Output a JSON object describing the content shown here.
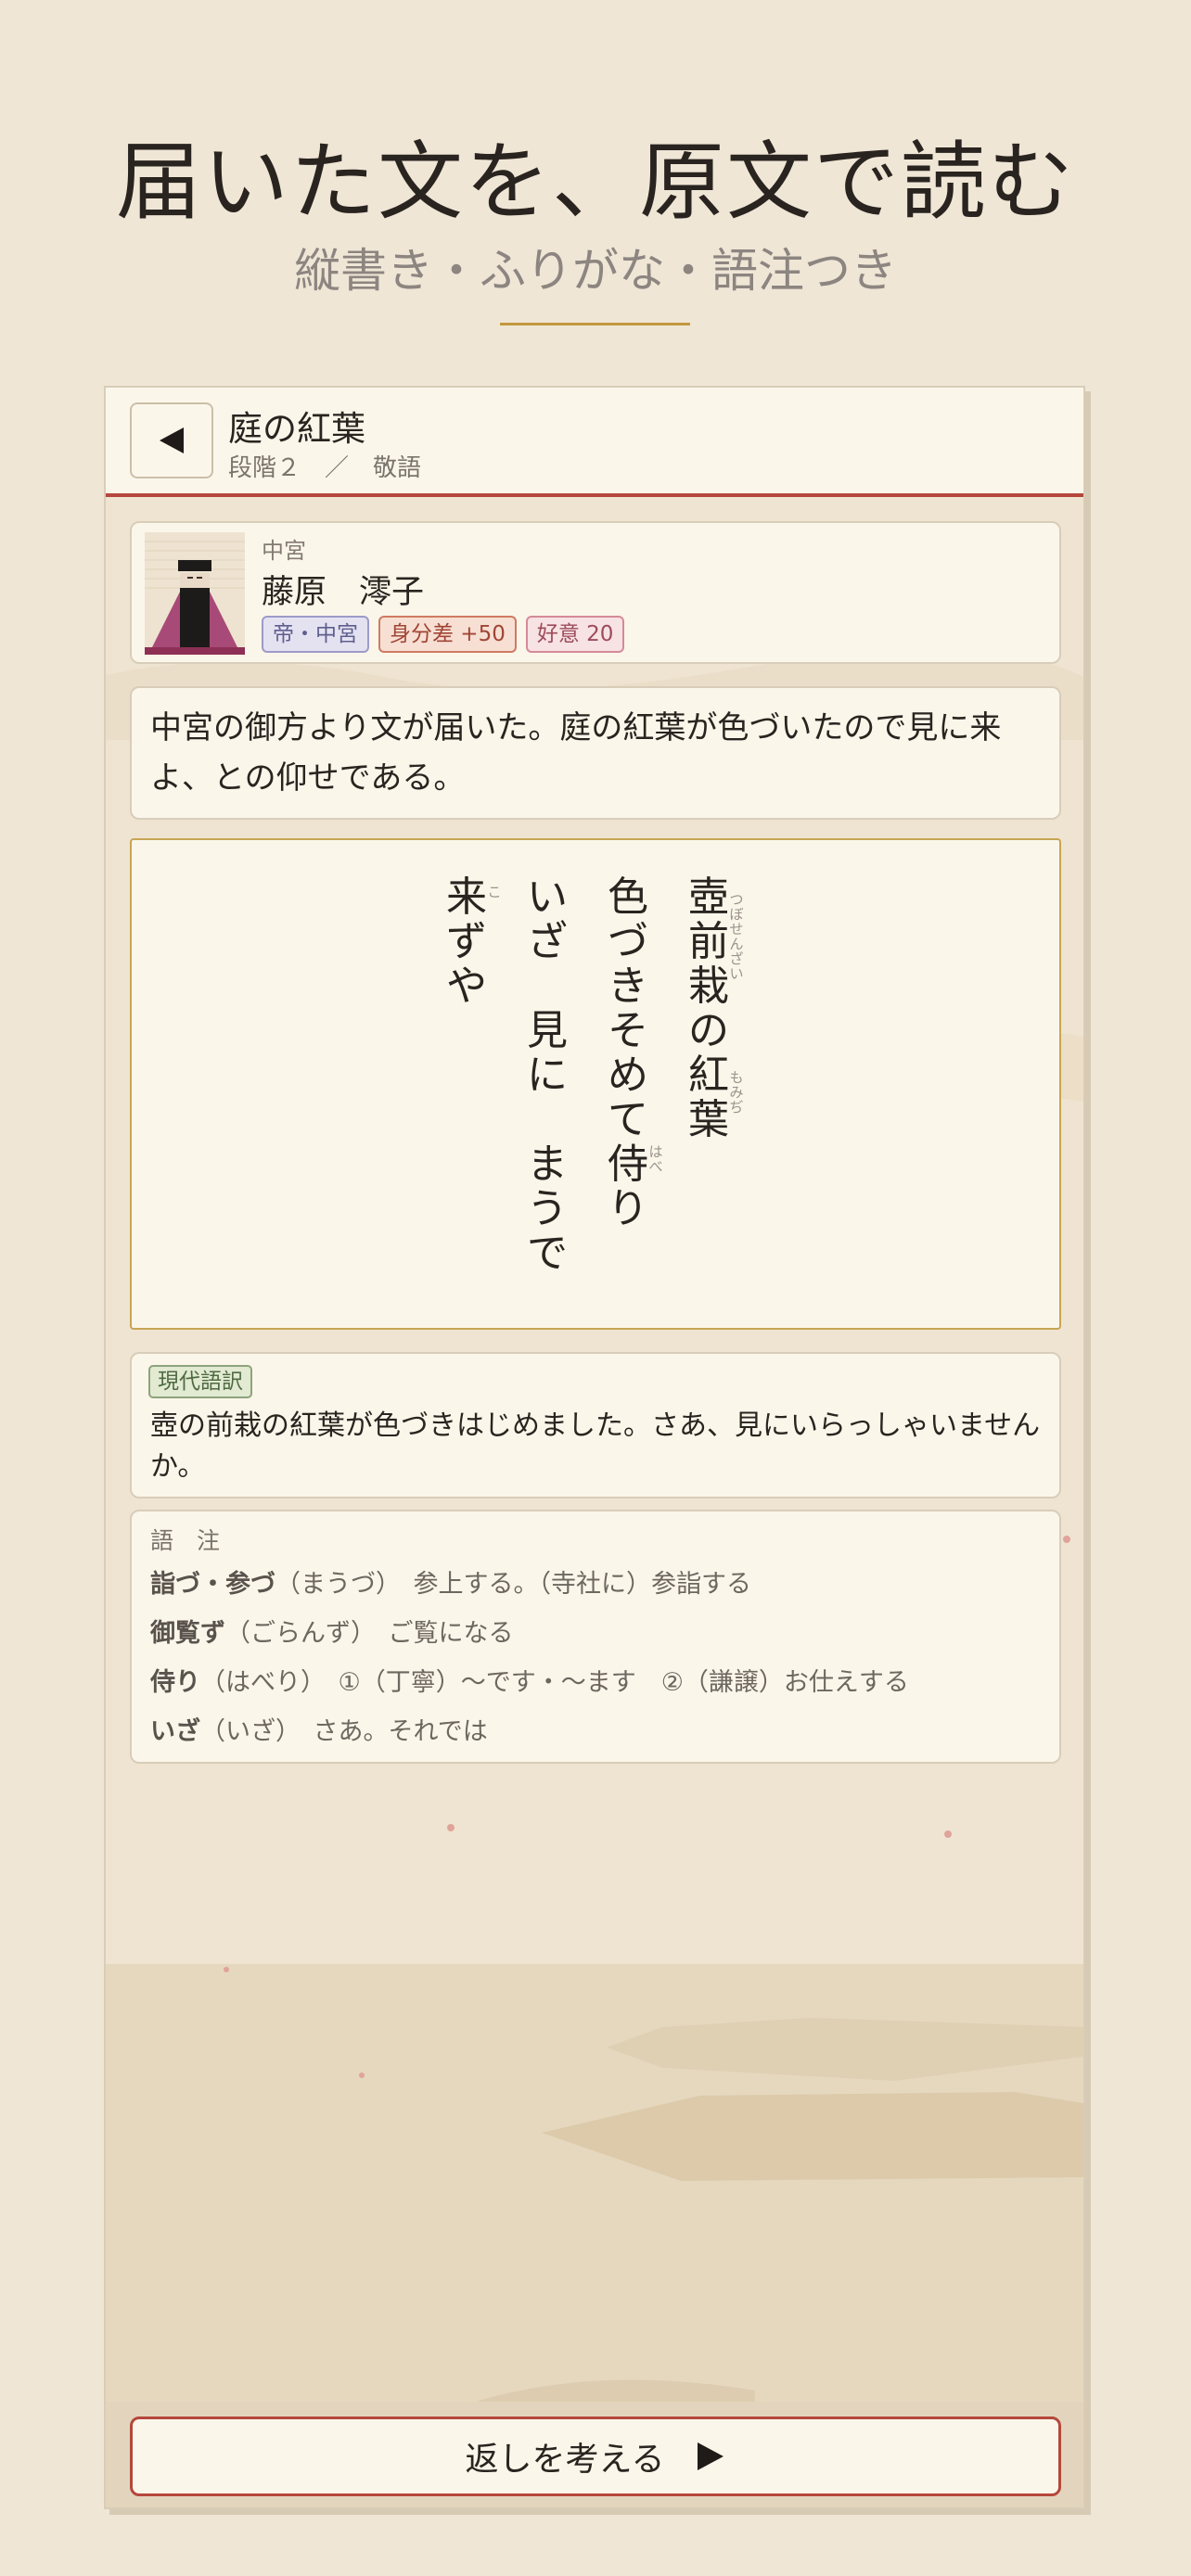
{
  "hero": {
    "title": "届いた文を、原文で読む",
    "subtitle": "縦書き・ふりがな・語注つき"
  },
  "header": {
    "back_icon": "triangle-left-icon",
    "title": "庭の紅葉",
    "meta": "段階２　／　敬語"
  },
  "sender": {
    "rank": "中宮",
    "name": "藤原　澪子",
    "badges": [
      "帝・中宮",
      "身分差 +50",
      "好意 20"
    ]
  },
  "narration": "中宮の御方より文が届いた。庭の紅葉が色づいたので見に来よ、との仰せである。",
  "poem": {
    "lines": [
      {
        "text": "壺前栽の紅葉",
        "ruby": [
          {
            "at": 0,
            "span": 3,
            "text": "つぼせんざい"
          },
          {
            "at": 4,
            "span": 2,
            "text": "もみぢ"
          }
        ]
      },
      {
        "text": "色づきそめて侍り",
        "ruby": [
          {
            "at": 6,
            "span": 1,
            "text": "はべ"
          }
        ]
      },
      {
        "text": "いざ　見に　まうで",
        "ruby": []
      },
      {
        "text": "来ずや",
        "ruby": [
          {
            "at": 0,
            "span": 1,
            "text": "こ"
          }
        ]
      }
    ]
  },
  "translation": {
    "tag": "現代語訳",
    "text": "壺の前栽の紅葉が色づきはじめました。さあ、見にいらっしゃいませんか。"
  },
  "notes": {
    "title": "語　注",
    "items": [
      {
        "term": "詣づ・参づ",
        "reading": "（まうづ）",
        "gloss": "　参上する。（寺社に）参詣する"
      },
      {
        "term": "御覧ず",
        "reading": "（ごらんず）",
        "gloss": "　ご覧になる"
      },
      {
        "term": "侍り",
        "reading": "（はべり）",
        "gloss": "　①（丁寧）〜です・〜ます　②（謙譲）お仕えする"
      },
      {
        "term": "いざ",
        "reading": "（いざ）",
        "gloss": "　さあ。それでは"
      }
    ]
  },
  "reply": {
    "label": "返しを考える",
    "icon": "triangle-right-icon"
  },
  "colors": {
    "background": "#efe6d6",
    "accent_red": "#b5473c",
    "accent_gold": "#c2973d",
    "paper": "#fbf6ea"
  }
}
